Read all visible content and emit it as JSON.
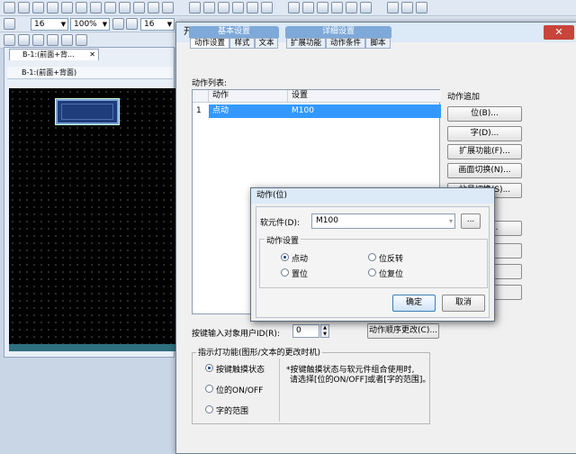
{
  "toolbar": {
    "combo_a": "16",
    "zoom": "100%",
    "combo_b": "16"
  },
  "editor": {
    "tab_label": "B-1:(前面+背...",
    "window_title": "B-1:(前面+背面)"
  },
  "dialog": {
    "title": "开关",
    "close_glyph": "✕",
    "tab_groups": [
      "基本设置",
      "详细设置"
    ],
    "subtabs": [
      "动作设置",
      "样式",
      "文本",
      "扩展功能",
      "动作条件",
      "脚本"
    ],
    "action_list_label": "动作列表:",
    "action_add_label": "动作追加",
    "table": {
      "headers": [
        "动作",
        "设置"
      ],
      "rows": [
        {
          "num": "1",
          "action": "点动",
          "setting": "M100"
        }
      ]
    },
    "side_buttons": [
      "位(B)...",
      "字(D)...",
      "扩展功能(F)...",
      "画面切换(N)...",
      "站号切换(S)...",
      "...(P)..."
    ],
    "user_id_label": "按键输入对象用户ID(R):",
    "user_id_value": "0",
    "order_button": "动作顺序更改(C)...",
    "indicator_label": "指示灯功能(图形/文本的更改时机)",
    "indicator_options": [
      "按键触摸状态",
      "位的ON/OFF",
      "字的范围"
    ],
    "indicator_note_1": "*按键触摸状态与软元件组合使用时,",
    "indicator_note_2": "请选择[位的ON/OFF]或者[字的范围]。"
  },
  "subdialog": {
    "title": "动作(位)",
    "device_label": "软元件(D):",
    "device_value": "M100",
    "browse": "...",
    "action_setting_label": "动作设置",
    "options": [
      "点动",
      "位反转",
      "置位",
      "位复位"
    ],
    "ok": "确定",
    "cancel": "取消"
  }
}
